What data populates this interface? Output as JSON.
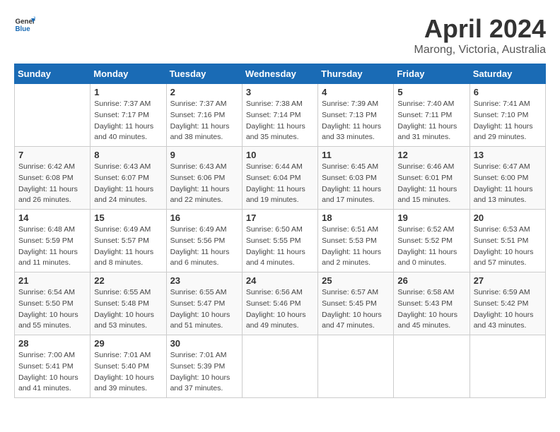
{
  "header": {
    "logo_line1": "General",
    "logo_line2": "Blue",
    "title": "April 2024",
    "subtitle": "Marong, Victoria, Australia"
  },
  "calendar": {
    "headers": [
      "Sunday",
      "Monday",
      "Tuesday",
      "Wednesday",
      "Thursday",
      "Friday",
      "Saturday"
    ],
    "weeks": [
      [
        {
          "day": "",
          "info": ""
        },
        {
          "day": "1",
          "info": "Sunrise: 7:37 AM\nSunset: 7:17 PM\nDaylight: 11 hours\nand 40 minutes."
        },
        {
          "day": "2",
          "info": "Sunrise: 7:37 AM\nSunset: 7:16 PM\nDaylight: 11 hours\nand 38 minutes."
        },
        {
          "day": "3",
          "info": "Sunrise: 7:38 AM\nSunset: 7:14 PM\nDaylight: 11 hours\nand 35 minutes."
        },
        {
          "day": "4",
          "info": "Sunrise: 7:39 AM\nSunset: 7:13 PM\nDaylight: 11 hours\nand 33 minutes."
        },
        {
          "day": "5",
          "info": "Sunrise: 7:40 AM\nSunset: 7:11 PM\nDaylight: 11 hours\nand 31 minutes."
        },
        {
          "day": "6",
          "info": "Sunrise: 7:41 AM\nSunset: 7:10 PM\nDaylight: 11 hours\nand 29 minutes."
        }
      ],
      [
        {
          "day": "7",
          "info": "Sunrise: 6:42 AM\nSunset: 6:08 PM\nDaylight: 11 hours\nand 26 minutes."
        },
        {
          "day": "8",
          "info": "Sunrise: 6:43 AM\nSunset: 6:07 PM\nDaylight: 11 hours\nand 24 minutes."
        },
        {
          "day": "9",
          "info": "Sunrise: 6:43 AM\nSunset: 6:06 PM\nDaylight: 11 hours\nand 22 minutes."
        },
        {
          "day": "10",
          "info": "Sunrise: 6:44 AM\nSunset: 6:04 PM\nDaylight: 11 hours\nand 19 minutes."
        },
        {
          "day": "11",
          "info": "Sunrise: 6:45 AM\nSunset: 6:03 PM\nDaylight: 11 hours\nand 17 minutes."
        },
        {
          "day": "12",
          "info": "Sunrise: 6:46 AM\nSunset: 6:01 PM\nDaylight: 11 hours\nand 15 minutes."
        },
        {
          "day": "13",
          "info": "Sunrise: 6:47 AM\nSunset: 6:00 PM\nDaylight: 11 hours\nand 13 minutes."
        }
      ],
      [
        {
          "day": "14",
          "info": "Sunrise: 6:48 AM\nSunset: 5:59 PM\nDaylight: 11 hours\nand 11 minutes."
        },
        {
          "day": "15",
          "info": "Sunrise: 6:49 AM\nSunset: 5:57 PM\nDaylight: 11 hours\nand 8 minutes."
        },
        {
          "day": "16",
          "info": "Sunrise: 6:49 AM\nSunset: 5:56 PM\nDaylight: 11 hours\nand 6 minutes."
        },
        {
          "day": "17",
          "info": "Sunrise: 6:50 AM\nSunset: 5:55 PM\nDaylight: 11 hours\nand 4 minutes."
        },
        {
          "day": "18",
          "info": "Sunrise: 6:51 AM\nSunset: 5:53 PM\nDaylight: 11 hours\nand 2 minutes."
        },
        {
          "day": "19",
          "info": "Sunrise: 6:52 AM\nSunset: 5:52 PM\nDaylight: 11 hours\nand 0 minutes."
        },
        {
          "day": "20",
          "info": "Sunrise: 6:53 AM\nSunset: 5:51 PM\nDaylight: 10 hours\nand 57 minutes."
        }
      ],
      [
        {
          "day": "21",
          "info": "Sunrise: 6:54 AM\nSunset: 5:50 PM\nDaylight: 10 hours\nand 55 minutes."
        },
        {
          "day": "22",
          "info": "Sunrise: 6:55 AM\nSunset: 5:48 PM\nDaylight: 10 hours\nand 53 minutes."
        },
        {
          "day": "23",
          "info": "Sunrise: 6:55 AM\nSunset: 5:47 PM\nDaylight: 10 hours\nand 51 minutes."
        },
        {
          "day": "24",
          "info": "Sunrise: 6:56 AM\nSunset: 5:46 PM\nDaylight: 10 hours\nand 49 minutes."
        },
        {
          "day": "25",
          "info": "Sunrise: 6:57 AM\nSunset: 5:45 PM\nDaylight: 10 hours\nand 47 minutes."
        },
        {
          "day": "26",
          "info": "Sunrise: 6:58 AM\nSunset: 5:43 PM\nDaylight: 10 hours\nand 45 minutes."
        },
        {
          "day": "27",
          "info": "Sunrise: 6:59 AM\nSunset: 5:42 PM\nDaylight: 10 hours\nand 43 minutes."
        }
      ],
      [
        {
          "day": "28",
          "info": "Sunrise: 7:00 AM\nSunset: 5:41 PM\nDaylight: 10 hours\nand 41 minutes."
        },
        {
          "day": "29",
          "info": "Sunrise: 7:01 AM\nSunset: 5:40 PM\nDaylight: 10 hours\nand 39 minutes."
        },
        {
          "day": "30",
          "info": "Sunrise: 7:01 AM\nSunset: 5:39 PM\nDaylight: 10 hours\nand 37 minutes."
        },
        {
          "day": "",
          "info": ""
        },
        {
          "day": "",
          "info": ""
        },
        {
          "day": "",
          "info": ""
        },
        {
          "day": "",
          "info": ""
        }
      ]
    ]
  }
}
